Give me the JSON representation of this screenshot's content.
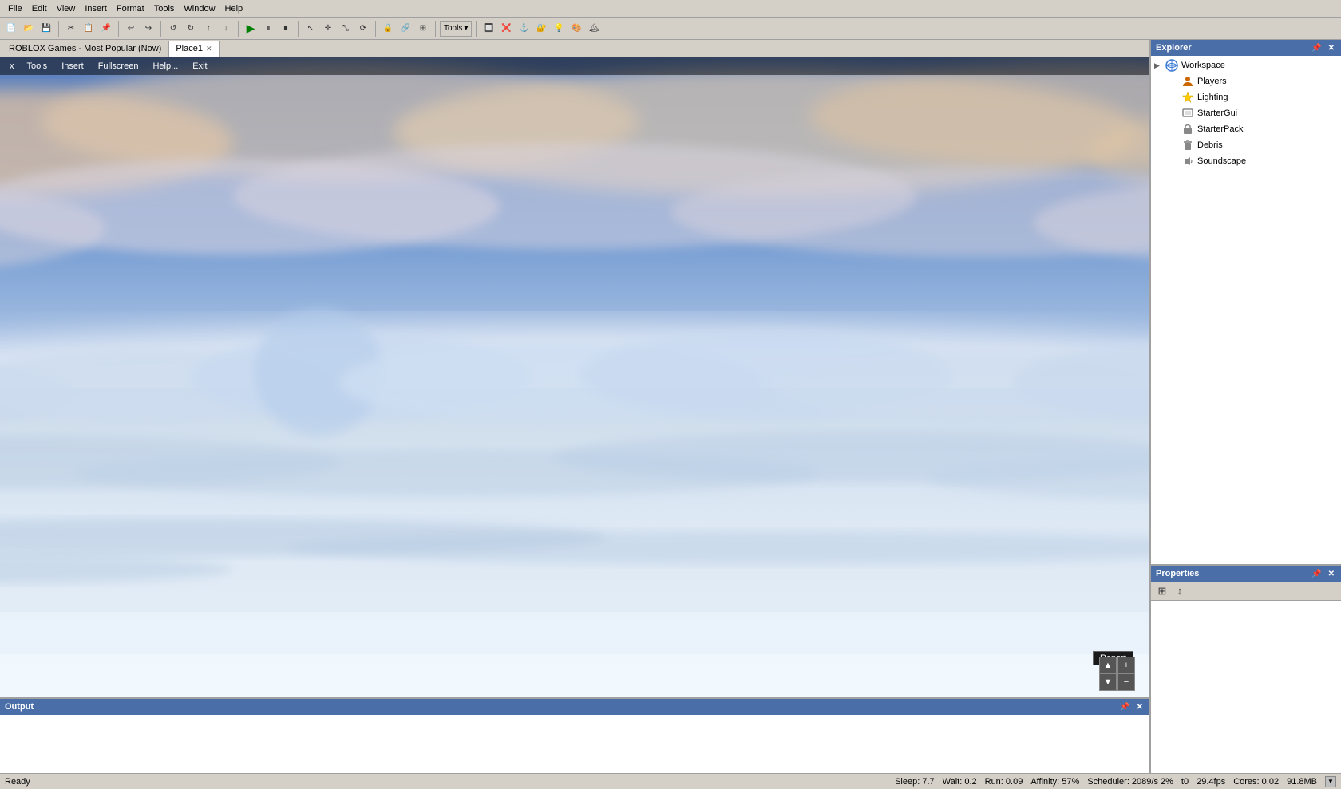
{
  "menubar": {
    "items": [
      "File",
      "Edit",
      "View",
      "Insert",
      "Format",
      "Tools",
      "Window",
      "Help"
    ]
  },
  "toolbar": {
    "groups": [
      {
        "buttons": [
          "💾",
          "📁",
          "📋",
          "✂️",
          "📋",
          "🔄",
          "↩",
          "↪"
        ]
      },
      {
        "buttons": [
          "▶",
          "⏸",
          "⏹"
        ]
      },
      {
        "buttons": [
          "↖",
          "➕",
          "✛",
          "🔒",
          "📐",
          "🔄",
          "⬡",
          "🔲"
        ]
      },
      {
        "buttons": [
          "🔧"
        ]
      },
      {
        "label": "Tools ▾"
      },
      {
        "buttons": [
          "🔲",
          "❌",
          "🔲",
          "🔲",
          "🔲",
          "🔲",
          "💡",
          "🎨"
        ]
      }
    ]
  },
  "tabbar": {
    "tabs": [
      {
        "label": "ROBLOX Games - Most Popular (Now)",
        "closable": false,
        "active": false
      },
      {
        "label": "Place1",
        "closable": true,
        "active": true
      }
    ]
  },
  "game_menu": {
    "close_label": "x",
    "items": [
      "Tools",
      "Insert",
      "Fullscreen",
      "Help...",
      "Exit"
    ]
  },
  "explorer": {
    "title": "Explorer",
    "items": [
      {
        "label": "Workspace",
        "icon": "🌐",
        "color": "#3a7bd5",
        "indent": 0,
        "expanded": true
      },
      {
        "label": "Players",
        "icon": "👤",
        "color": "#cc6600",
        "indent": 1,
        "expanded": false
      },
      {
        "label": "Lighting",
        "icon": "⭐",
        "color": "#ffcc00",
        "indent": 1,
        "expanded": false
      },
      {
        "label": "StarterGui",
        "icon": "🖼",
        "color": "#888888",
        "indent": 1,
        "expanded": false
      },
      {
        "label": "StarterPack",
        "icon": "🎒",
        "color": "#888888",
        "indent": 1,
        "expanded": false
      },
      {
        "label": "Debris",
        "icon": "🗑",
        "color": "#888888",
        "indent": 1,
        "expanded": false
      },
      {
        "label": "Soundscape",
        "icon": "🔊",
        "color": "#888888",
        "indent": 1,
        "expanded": false
      }
    ]
  },
  "properties": {
    "title": "Properties"
  },
  "output": {
    "title": "Output"
  },
  "statusbar": {
    "left": "Ready",
    "right": {
      "sleep": "Sleep: 7.7",
      "wait": "Wait: 0.2",
      "run": "Run: 0.09",
      "affinity": "Affinity: 57%",
      "scheduler": "Scheduler: 2089/s 2%",
      "t0": "t0",
      "fps": "29.4fps",
      "cores": "Cores: 0.02",
      "memory": "91.8MB"
    }
  },
  "report_btn": "Report",
  "nav_btns": {
    "up": "▲",
    "down": "▼",
    "plus": "+",
    "minus": "−"
  }
}
